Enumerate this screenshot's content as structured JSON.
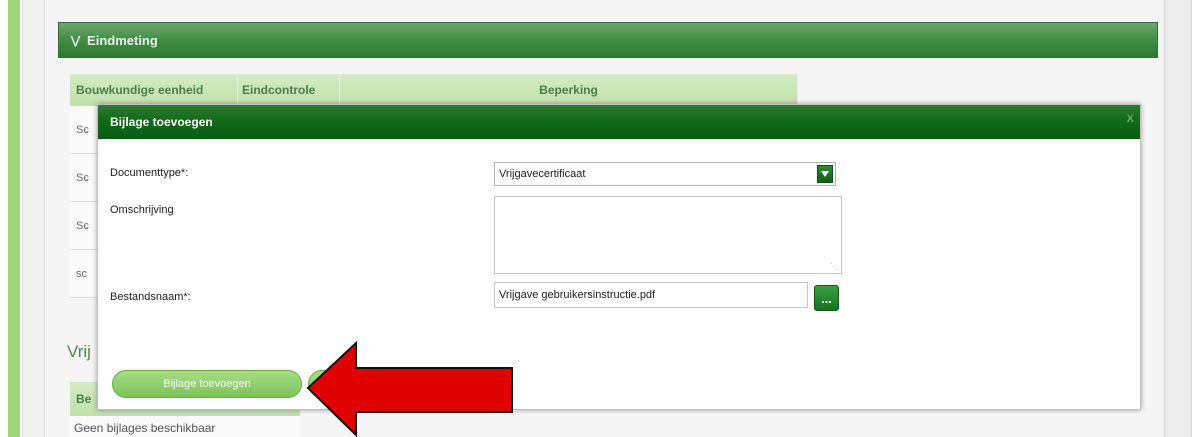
{
  "section": {
    "title": "Eindmeting"
  },
  "background_table": {
    "headers": [
      "Bouwkundige eenheid",
      "Eindcontrole",
      "Beperking"
    ],
    "row_fragments": [
      "Sc",
      "Sc",
      "Sc",
      "sc"
    ]
  },
  "vrijgave": {
    "title_fragment": "Vrij",
    "header_fragment": "Be",
    "empty_text": "Geen bijlages beschikbaar"
  },
  "dialog": {
    "title": "Bijlage toevoegen",
    "close_label": "X",
    "documenttype_label": "Documenttype*:",
    "documenttype_value": "Vrijgavecertificaat",
    "omschrijving_label": "Omschrijving",
    "omschrijving_value": "",
    "bestandsnaam_label": "Bestandsnaam*:",
    "bestandsnaam_value": "Vrijgave gebruikersinstructie.pdf",
    "browse_label": "...",
    "submit_label": "Bijlage toevoegen"
  },
  "colors": {
    "header_green": "#3f8a43",
    "dialog_title_green": "#116b18",
    "button_green": "#7cc25a",
    "arrow_red": "#e00000"
  }
}
